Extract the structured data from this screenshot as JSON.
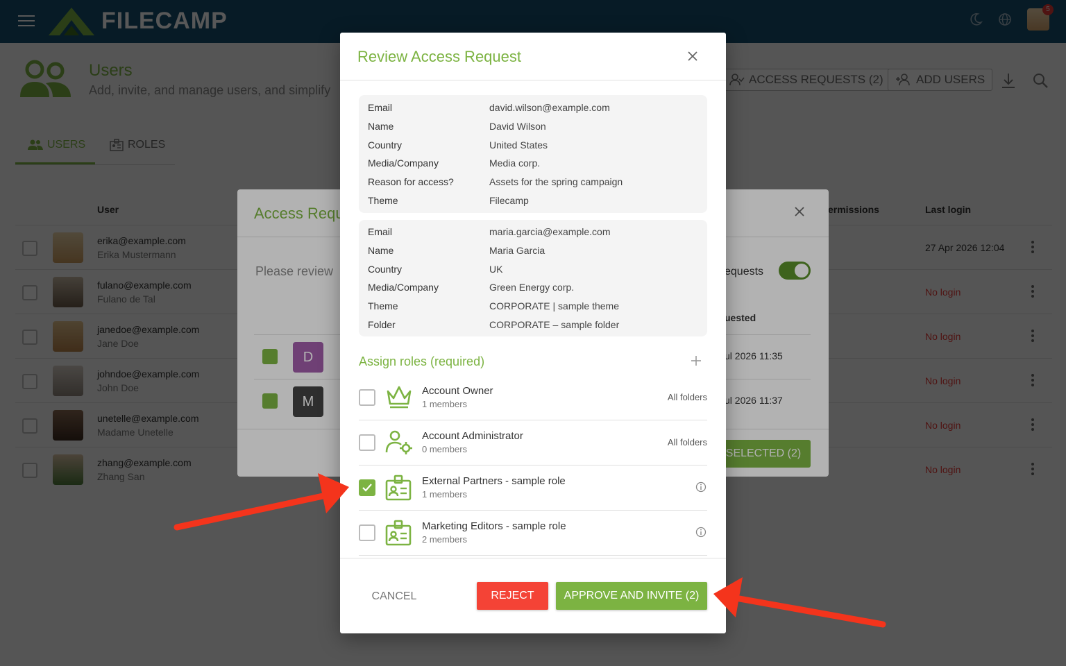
{
  "app": {
    "logo_text": "FILECAMP",
    "notification_count": "5"
  },
  "page": {
    "title": "Users",
    "subtitle": "Add, invite, and manage users, and simplify",
    "access_requests_label": "ACCESS REQUESTS (2)",
    "add_users_label": "ADD USERS"
  },
  "tabs": [
    {
      "label": "USERS"
    },
    {
      "label": "ROLES"
    }
  ],
  "users_table": {
    "col_user": "User",
    "col_permissions": "ermissions",
    "col_last_login": "Last login",
    "rows": [
      {
        "email": "erika@example.com",
        "name": "Erika Mustermann",
        "last_login": "27 Apr 2026 12:04"
      },
      {
        "email": "fulano@example.com",
        "name": "Fulano de Tal",
        "last_login": "No login"
      },
      {
        "email": "janedoe@example.com",
        "name": "Jane Doe",
        "last_login": "No login"
      },
      {
        "email": "johndoe@example.com",
        "name": "John Doe",
        "last_login": "No login"
      },
      {
        "email": "unetelle@example.com",
        "name": "Madame Unetelle",
        "last_login": "No login"
      },
      {
        "email": "zhang@example.com",
        "name": "Zhang San",
        "last_login": "No login"
      }
    ]
  },
  "back_modal": {
    "title": "Access Requ",
    "review_text": "Please review",
    "requests_label": "equests",
    "requested_col": "uested",
    "rows": [
      {
        "letter": "D",
        "letter_color": "#a05ca8",
        "date": "ul 2026 11:35"
      },
      {
        "letter": "M",
        "letter_color": "#424242",
        "date": "ul 2026 11:37"
      }
    ],
    "selected_button": "SELECTED (2)"
  },
  "modal": {
    "title": "Review Access Request",
    "requests": [
      {
        "fields": [
          {
            "key": "Email",
            "value": "david.wilson@example.com"
          },
          {
            "key": "Name",
            "value": "David Wilson"
          },
          {
            "key": "Country",
            "value": "United States"
          },
          {
            "key": "Media/Company",
            "value": "Media corp."
          },
          {
            "key": "Reason for access?",
            "value": "Assets for the spring campaign"
          },
          {
            "key": "Theme",
            "value": "Filecamp"
          }
        ]
      },
      {
        "fields": [
          {
            "key": "Email",
            "value": "maria.garcia@example.com"
          },
          {
            "key": "Name",
            "value": "Maria Garcia"
          },
          {
            "key": "Country",
            "value": "UK"
          },
          {
            "key": "Media/Company",
            "value": "Green Energy corp."
          },
          {
            "key": "Theme",
            "value": "CORPORATE | sample theme"
          },
          {
            "key": "Folder",
            "value": "CORPORATE – sample folder"
          }
        ]
      }
    ],
    "roles_title": "Assign roles (required)",
    "roles": [
      {
        "name": "Account Owner",
        "members": "1 members",
        "scope": "All folders",
        "checked": false,
        "icon": "crown-icon"
      },
      {
        "name": "Account Administrator",
        "members": "0 members",
        "scope": "All folders",
        "checked": false,
        "icon": "user-gear-icon"
      },
      {
        "name": "External Partners - sample role",
        "members": "1 members",
        "scope": "",
        "checked": true,
        "icon": "id-badge-icon"
      },
      {
        "name": "Marketing Editors - sample role",
        "members": "2 members",
        "scope": "",
        "checked": false,
        "icon": "id-badge-icon"
      }
    ],
    "cancel_label": "CANCEL",
    "reject_label": "REJECT",
    "approve_label": "APPROVE AND INVITE (2)"
  },
  "colors": {
    "brand_green": "#7cb342",
    "topbar": "#16506e",
    "reject_red": "#f44336",
    "annotation_arrow": "#f4341c"
  }
}
